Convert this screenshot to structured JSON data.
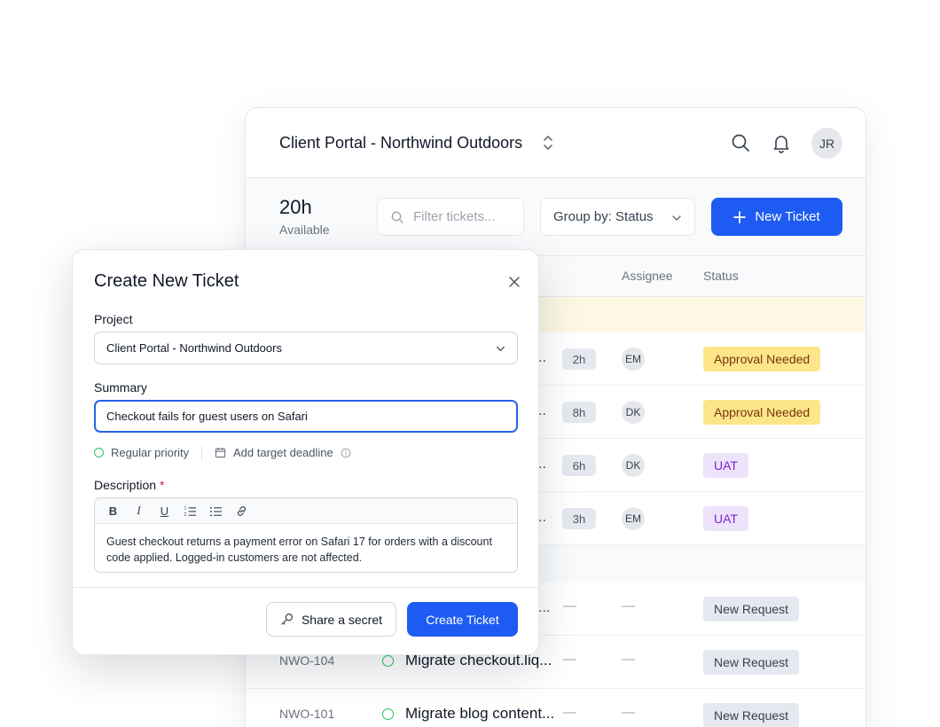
{
  "app": {
    "project_title": "Client Portal - Northwind Outdoors",
    "user_initials": "JR",
    "available_hours": "20h",
    "available_label": "Available",
    "filter_placeholder": "Filter tickets...",
    "group_by": "Group by: Status",
    "new_ticket_label": "New Ticket",
    "columns": {
      "assignee": "Assignee",
      "status": "Status"
    },
    "active_rows": [
      {
        "trunc": "..",
        "hours": "2h",
        "assignee": "EM",
        "status": "Approval Needed"
      },
      {
        "trunc": "..",
        "hours": "8h",
        "assignee": "DK",
        "status": "Approval Needed"
      },
      {
        "trunc": "..",
        "hours": "6h",
        "assignee": "DK",
        "status": "UAT"
      },
      {
        "trunc": "..",
        "hours": "3h",
        "assignee": "EM",
        "status": "UAT"
      }
    ],
    "new_rows": [
      {
        "id": "",
        "name": "",
        "trunc": "...",
        "hours": "—",
        "assignee": "—",
        "status": "New Request"
      },
      {
        "id": "NWO-104",
        "name": "Migrate checkout.liq...",
        "hours": "—",
        "assignee": "—",
        "status": "New Request"
      },
      {
        "id": "NWO-101",
        "name": "Migrate blog content...",
        "hours": "—",
        "assignee": "—",
        "status": "New Request"
      }
    ]
  },
  "modal": {
    "title": "Create New Ticket",
    "project_label": "Project",
    "project_value": "Client Portal - Northwind Outdoors",
    "summary_label": "Summary",
    "summary_value": "Checkout fails for guest users on Safari",
    "priority": "Regular priority",
    "deadline": "Add target deadline",
    "description_label": "Description",
    "required_mark": "*",
    "editor_tools": [
      "bold-icon",
      "italic-icon",
      "underline-icon",
      "ordered-list-icon",
      "bullet-list-icon",
      "link-icon"
    ],
    "description_text": "Guest checkout returns a payment error on Safari 17 for orders with a discount code applied. Logged-in customers are not affected.",
    "share_secret_label": "Share a secret",
    "create_label": "Create Ticket"
  },
  "colors": {
    "accent": "#1d5bf2",
    "approval_bg": "#fde68a",
    "uat_bg": "#ede3fb",
    "priority_ring": "#22c55e",
    "required": "#e11d48"
  }
}
